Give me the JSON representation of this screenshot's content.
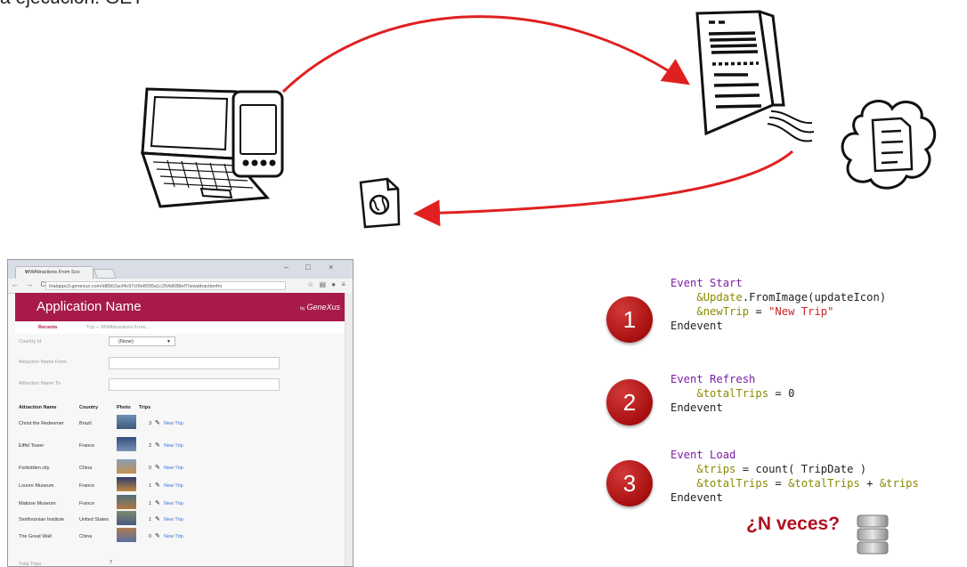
{
  "heading": "a ejecución: GET",
  "browser": {
    "tab_title": "WWAttractions From Sco",
    "tab_close": "×",
    "window_buttons": [
      "–",
      "□",
      "×"
    ],
    "nav_icons": "← → C",
    "url": "trialapps3.genexus.com/id8562acf4c97c0fe8095a1c264d688ef7/wwattractionfro",
    "app_name": "Application Name",
    "brand_by": "by",
    "brand": "GeneXus",
    "breadcrumb": [
      "Recents",
      "Trip  ››  WWAttractions From..."
    ],
    "filters": [
      {
        "label": "Country Id",
        "value": "(None)"
      },
      {
        "label": "Attraction Name From",
        "value": ""
      },
      {
        "label": "Attraction Name To",
        "value": ""
      }
    ],
    "columns": [
      "Attraction Name",
      "Country",
      "Photo",
      "Trips"
    ],
    "rows": [
      {
        "name": "Christ the Redeemer",
        "country": "Brazil",
        "trips": "3",
        "action": "New Trip"
      },
      {
        "name": "Eiffel Tower",
        "country": "France",
        "trips": "2",
        "action": "New Trip"
      },
      {
        "name": "Forbidden city",
        "country": "China",
        "trips": "0",
        "action": "New Trip"
      },
      {
        "name": "Louvre Museum",
        "country": "France",
        "trips": "1",
        "action": "New Trip"
      },
      {
        "name": "Matisse Museum",
        "country": "France",
        "trips": "1",
        "action": "New Trip"
      },
      {
        "name": "Smithsonian Institute",
        "country": "United States",
        "trips": "1",
        "action": "New Trip"
      },
      {
        "name": "The Great Wall",
        "country": "China",
        "trips": "0",
        "action": "New Trip"
      }
    ],
    "total_label": "Total Trips",
    "total_value": "7"
  },
  "events": [
    {
      "number": "1",
      "header": "Event Start",
      "lines": [
        [
          {
            "t": "&Update",
            "c": "id"
          },
          {
            "t": ".FromImage(updateIcon)",
            "c": "plain"
          }
        ],
        [
          {
            "t": "&newTrip",
            "c": "id"
          },
          {
            "t": " = ",
            "c": "plain"
          },
          {
            "t": "\"New Trip\"",
            "c": "str"
          }
        ]
      ],
      "footer": "Endevent"
    },
    {
      "number": "2",
      "header": "Event Refresh",
      "lines": [
        [
          {
            "t": "&totalTrips",
            "c": "id"
          },
          {
            "t": " = 0",
            "c": "plain"
          }
        ]
      ],
      "footer": "Endevent"
    },
    {
      "number": "3",
      "header": "Event Load",
      "lines": [
        [
          {
            "t": "&trips",
            "c": "id"
          },
          {
            "t": " = count( TripDate )",
            "c": "plain"
          }
        ],
        [
          {
            "t": "&totalTrips",
            "c": "id"
          },
          {
            "t": " = ",
            "c": "plain"
          },
          {
            "t": "&totalTrips",
            "c": "id"
          },
          {
            "t": " + ",
            "c": "plain"
          },
          {
            "t": "&trips",
            "c": "id"
          }
        ]
      ],
      "footer": "Endevent"
    }
  ],
  "annotation": "¿N veces?",
  "colors": {
    "arrow": "#e02020",
    "app_header": "#a71a4b",
    "keyword": "#7b1fa2",
    "variable": "#8a8a00",
    "string": "#c62828",
    "badge": "#b01515",
    "annotation": "#b01020"
  },
  "icons": [
    "laptop-icon",
    "smartphone-icon",
    "server-icon",
    "cloud-document-icon",
    "web-page-icon",
    "database-icon",
    "pencil-icon"
  ]
}
